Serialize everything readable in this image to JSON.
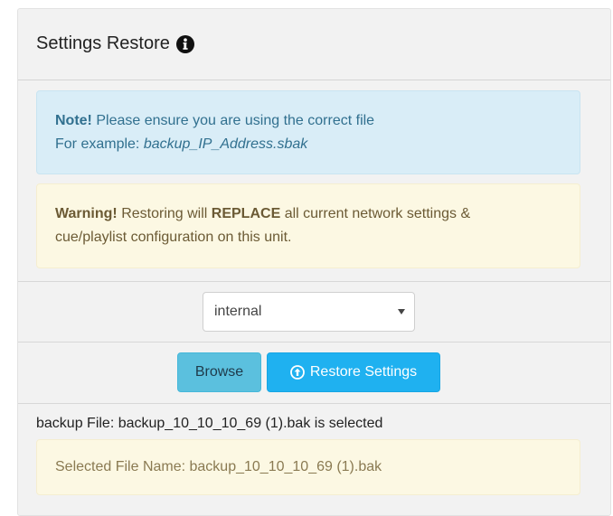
{
  "panel": {
    "title": "Settings Restore",
    "title_icon": "info-circle-icon"
  },
  "note": {
    "label": "Note!",
    "text": "Please ensure you are using the correct file",
    "example_prefix": "For example:",
    "example_value": "backup_IP_Address.sbak"
  },
  "warning": {
    "label": "Warning!",
    "text_before": "Restoring will",
    "emphasis": "REPLACE",
    "text_after": "all current network settings &",
    "line2": "cue/playlist configuration on this unit."
  },
  "source_select": {
    "selected": "internal"
  },
  "buttons": {
    "browse": "Browse",
    "restore": "Restore Settings",
    "restore_icon": "arrow-circle-up-icon"
  },
  "file_status": "backup File: backup_10_10_10_69 (1).bak is selected",
  "selected_file": "Selected File Name: backup_10_10_10_69 (1).bak",
  "colors": {
    "info_bg": "#d9edf7",
    "warning_bg": "#fcf8e3",
    "browse_bg": "#5bc0de",
    "restore_bg": "#1fb1f0"
  }
}
